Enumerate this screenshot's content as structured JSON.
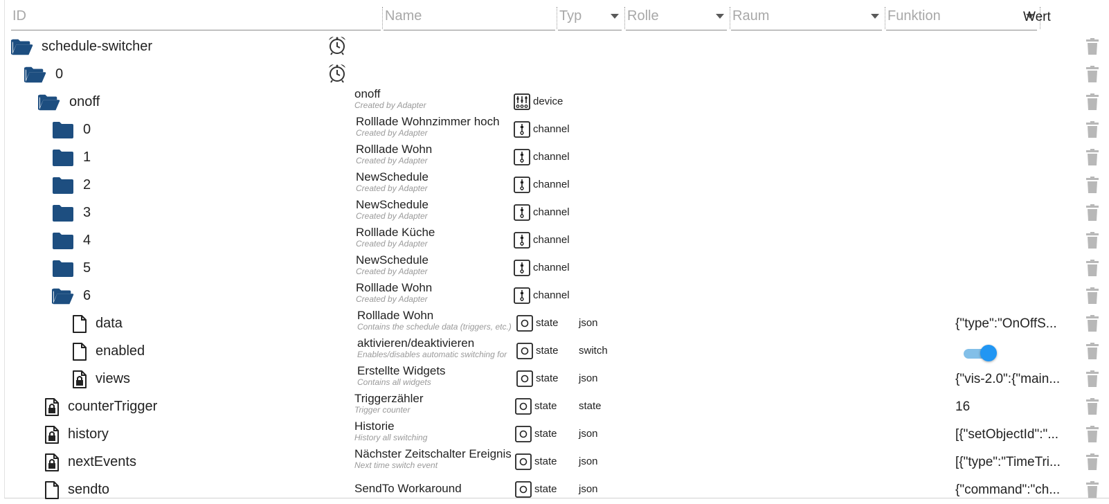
{
  "header": {
    "id": "ID",
    "name": "Name",
    "typ": "Typ",
    "rolle": "Rolle",
    "raum": "Raum",
    "funktion": "Funktion",
    "wert": "Wert"
  },
  "rows": [
    {
      "id": "schedule-switcher",
      "icon": "folder-open-icon",
      "name": "",
      "subtitle": "",
      "type": "",
      "role": "",
      "value": ""
    },
    {
      "id": "0",
      "icon": "folder-open-icon",
      "name": "",
      "subtitle": "",
      "type": "",
      "role": "",
      "value": ""
    },
    {
      "id": "onoff",
      "icon": "folder-open-icon",
      "name": "onoff",
      "subtitle": "Created by Adapter",
      "type": "device",
      "role": "",
      "value": ""
    },
    {
      "id": "0",
      "icon": "folder-icon",
      "name": "Rolllade Wohnzimmer hoch",
      "subtitle": "Created by Adapter",
      "type": "channel",
      "role": "",
      "value": ""
    },
    {
      "id": "1",
      "icon": "folder-icon",
      "name": "Rolllade Wohn",
      "subtitle": "Created by Adapter",
      "type": "channel",
      "role": "",
      "value": ""
    },
    {
      "id": "2",
      "icon": "folder-icon",
      "name": "NewSchedule",
      "subtitle": "Created by Adapter",
      "type": "channel",
      "role": "",
      "value": ""
    },
    {
      "id": "3",
      "icon": "folder-icon",
      "name": "NewSchedule",
      "subtitle": "Created by Adapter",
      "type": "channel",
      "role": "",
      "value": ""
    },
    {
      "id": "4",
      "icon": "folder-icon",
      "name": "Rolllade Küche",
      "subtitle": "Created by Adapter",
      "type": "channel",
      "role": "",
      "value": ""
    },
    {
      "id": "5",
      "icon": "folder-icon",
      "name": "NewSchedule",
      "subtitle": "Created by Adapter",
      "type": "channel",
      "role": "",
      "value": ""
    },
    {
      "id": "6",
      "icon": "folder-open-icon",
      "name": "Rolllade Wohn",
      "subtitle": "Created by Adapter",
      "type": "channel",
      "role": "",
      "value": ""
    },
    {
      "id": "data",
      "icon": "file-icon",
      "name": "Rolllade Wohn",
      "subtitle": "Contains the schedule data (triggers, etc.)",
      "type": "state",
      "role": "json",
      "value": "{\"type\":\"OnOffS..."
    },
    {
      "id": "enabled",
      "icon": "file-icon",
      "name": "aktivieren/deaktivieren",
      "subtitle": "Enables/disables automatic switching for",
      "type": "state",
      "role": "switch",
      "value": "",
      "toggle_on": true
    },
    {
      "id": "views",
      "icon": "file-lock-icon",
      "name": "Erstellte Widgets",
      "subtitle": "Contains all widgets",
      "type": "state",
      "role": "json",
      "value": "{\"vis-2.0\":{\"main..."
    },
    {
      "id": "counterTrigger",
      "icon": "file-lock-icon",
      "name": "Triggerzähler",
      "subtitle": "Trigger counter",
      "type": "state",
      "role": "state",
      "value": "16"
    },
    {
      "id": "history",
      "icon": "file-lock-icon",
      "name": "Historie",
      "subtitle": "History all switching",
      "type": "state",
      "role": "json",
      "value": "[{\"setObjectId\":\"..."
    },
    {
      "id": "nextEvents",
      "icon": "file-lock-icon",
      "name": "Nächster Zeitschalter Ereignis",
      "subtitle": "Next time switch event",
      "type": "state",
      "role": "json",
      "value": "[{\"type\":\"TimeTri..."
    },
    {
      "id": "sendto",
      "icon": "file-icon",
      "name": "SendTo Workaround",
      "subtitle": "",
      "type": "state",
      "role": "json",
      "value": "{\"command\":\"ch..."
    }
  ],
  "colors": {
    "folder": "#1d4e80",
    "toggle": "#2196f3",
    "trash": "#b8b8b8"
  }
}
